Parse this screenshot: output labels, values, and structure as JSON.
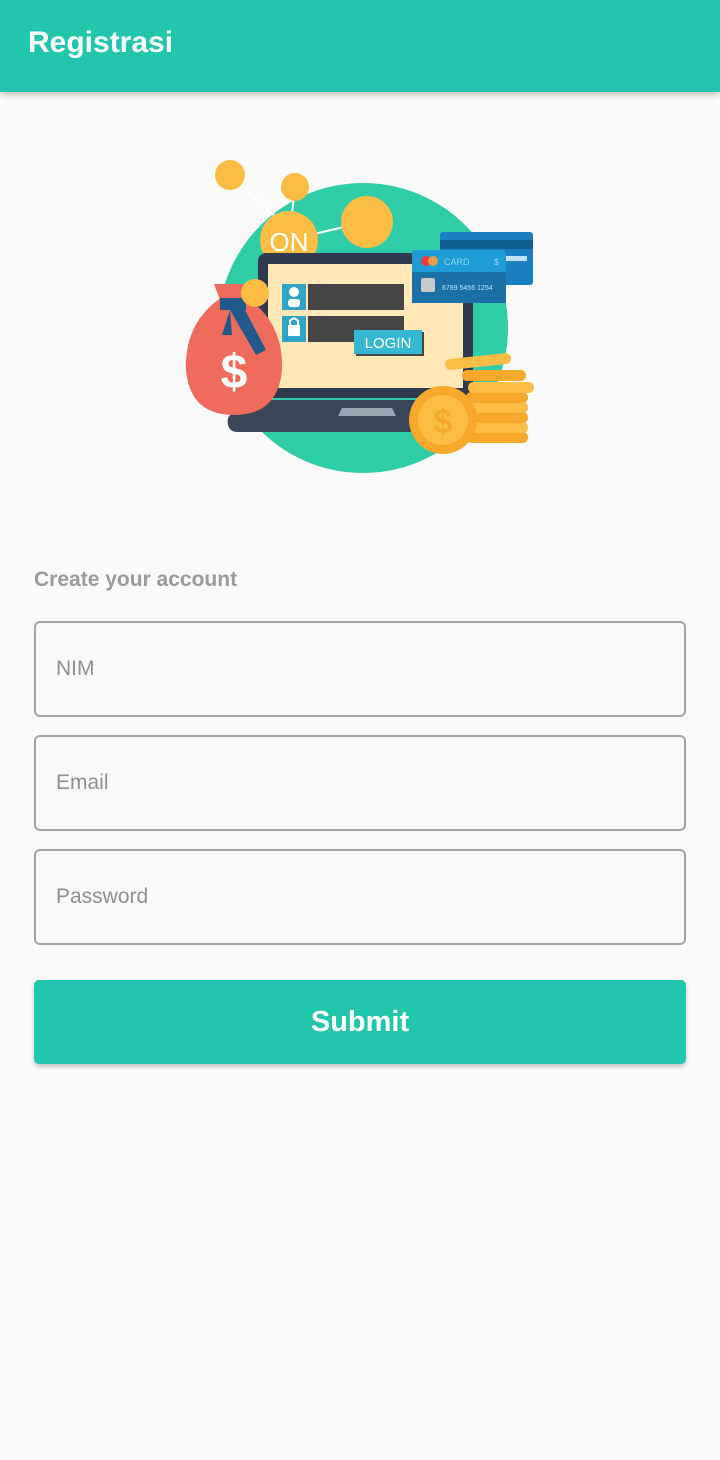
{
  "appbar": {
    "title": "Registrasi"
  },
  "illustration": {
    "on_text": "ON",
    "login_text": "LOGIN",
    "card_text": "CARD",
    "card_symbol": "$",
    "card_number": "6789 5456 1254",
    "money_symbol": "$"
  },
  "form": {
    "caption": "Create your account",
    "nim_placeholder": "NIM",
    "email_placeholder": "Email",
    "password_placeholder": "Password",
    "submit_label": "Submit"
  },
  "colors": {
    "primary": "#22c6ad",
    "background": "#fafafa",
    "caption": "#9a9a9a"
  }
}
